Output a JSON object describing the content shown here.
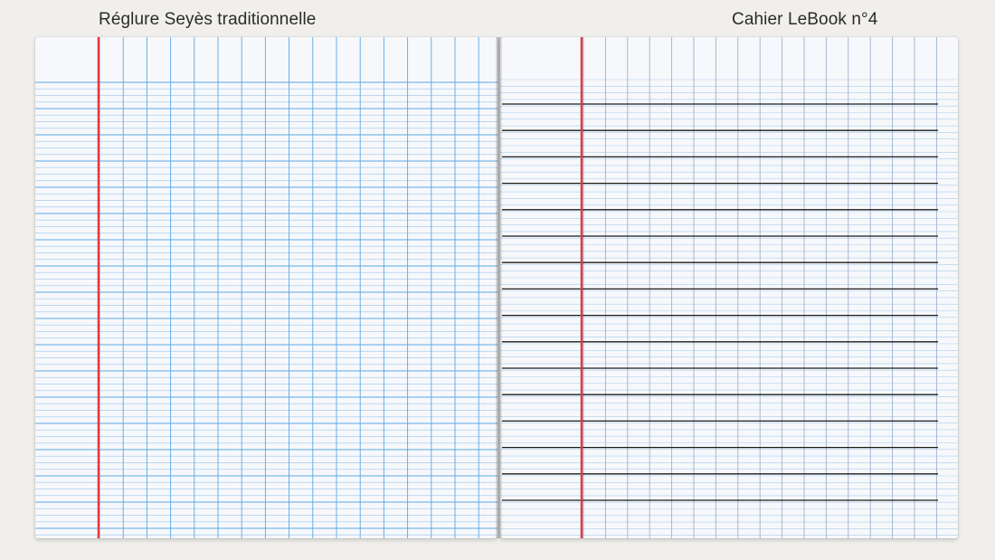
{
  "captions": {
    "left": "Réglure Seyès traditionnelle",
    "right": "Cahier LeBook n°4"
  },
  "colors": {
    "background": "#f0efec",
    "paper": "#f7f8fb",
    "seyes_blue": "#5aa8e6",
    "seyes_blue_light": "#a9cdee",
    "margin_red": "#e0393e",
    "lebook_black": "#1a1a1a",
    "lebook_grid": "#9fb2cc"
  },
  "pages": [
    {
      "name": "seyes-page",
      "ruling": "seyes-traditional"
    },
    {
      "name": "lebook-page",
      "ruling": "lebook-n4"
    }
  ]
}
